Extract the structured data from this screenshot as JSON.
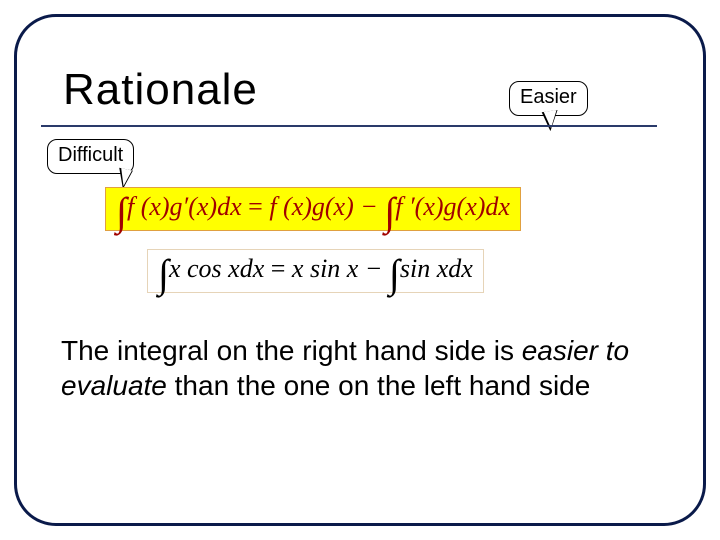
{
  "title": "Rationale",
  "callouts": {
    "easier": "Easier",
    "difficult": "Difficult"
  },
  "equations": {
    "general": {
      "lhs_int": "∫",
      "lhs": "f (x)g′(x)dx",
      "eq": " = ",
      "rhs1": "f (x)g(x) − ",
      "rhs_int": "∫",
      "rhs2": "f ′(x)g(x)dx"
    },
    "example": {
      "lhs_int": "∫",
      "lhs": "x cos xdx",
      "eq": " = ",
      "rhs1": "x sin x − ",
      "rhs_int": "∫",
      "rhs2": "sin xdx"
    }
  },
  "body": {
    "line1": "The integral on the right hand side is ",
    "em": "easier to evaluate",
    "line2": " than the one on the left hand side"
  }
}
